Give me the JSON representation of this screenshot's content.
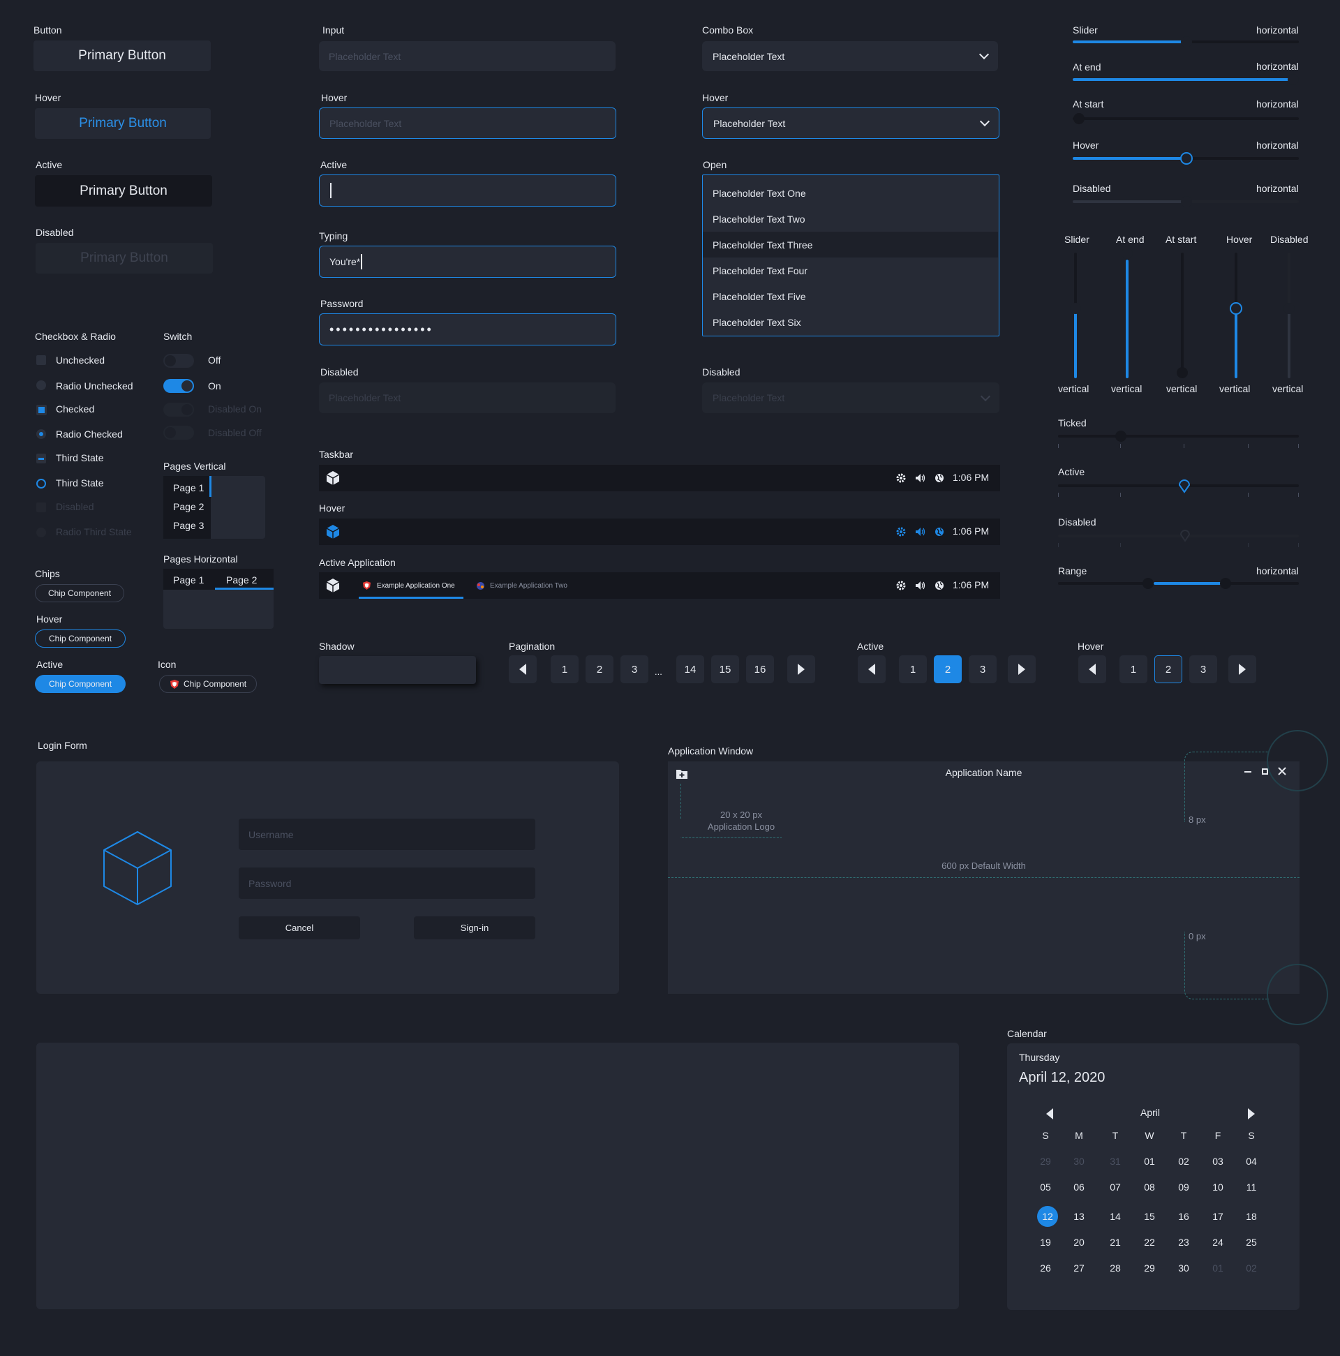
{
  "buttons": {
    "label": "Button",
    "primary": "Primary Button",
    "hover_label": "Hover",
    "hover": "Primary Button",
    "active_label": "Active",
    "active": "Primary Button",
    "disabled_label": "Disabled",
    "disabled": "Primary Button"
  },
  "inputs": {
    "label": "Input",
    "placeholder": "Placeholder Text",
    "hover_label": "Hover",
    "hover_placeholder": "Placeholder Text",
    "active_label": "Active",
    "typing_label": "Typing",
    "typing_value": "You're*",
    "password_label": "Password",
    "password_value": "••••••••••••••••",
    "disabled_label": "Disabled",
    "disabled_placeholder": "Placeholder Text"
  },
  "combo": {
    "label": "Combo Box",
    "value": "Placeholder Text",
    "hover_label": "Hover",
    "hover_value": "Placeholder Text",
    "open_label": "Open",
    "options": [
      "Placeholder Text One",
      "Placeholder Text Two",
      "Placeholder Text Three",
      "Placeholder Text Four",
      "Placeholder Text Five",
      "Placeholder Text Six"
    ],
    "disabled_label": "Disabled",
    "disabled_value": "Placeholder Text"
  },
  "sliders_h": [
    {
      "label": "Slider",
      "orientation": "horizontal",
      "value": 0.5
    },
    {
      "label": "At end",
      "orientation": "horizontal",
      "value": 1.0
    },
    {
      "label": "At start",
      "orientation": "horizontal",
      "value": 0.0
    },
    {
      "label": "Hover",
      "orientation": "horizontal",
      "value": 0.5
    },
    {
      "label": "Disabled",
      "orientation": "horizontal",
      "value": 0.5
    }
  ],
  "sliders_v": [
    {
      "label": "Slider",
      "orientation": "vertical",
      "value": 0.5
    },
    {
      "label": "At end",
      "orientation": "vertical",
      "value": 1.0
    },
    {
      "label": "At start",
      "orientation": "vertical",
      "value": 0.0
    },
    {
      "label": "Hover",
      "orientation": "vertical",
      "value": 0.5
    },
    {
      "label": "Disabled",
      "orientation": "vertical",
      "value": 0.5
    }
  ],
  "ticked": {
    "label": "Ticked",
    "active_label": "Active",
    "disabled_label": "Disabled"
  },
  "range": {
    "label": "Range",
    "orientation": "horizontal",
    "low": 0.38,
    "high": 0.7
  },
  "checkbox": {
    "title": "Checkbox & Radio",
    "items": [
      "Unchecked",
      "Radio Unchecked",
      "Checked",
      "Radio Checked",
      "Third State",
      "Third State",
      "Disabled",
      "Radio Third State"
    ]
  },
  "switch": {
    "title": "Switch",
    "items": [
      "Off",
      "On",
      "Disabled On",
      "Disabled Off"
    ]
  },
  "pages_vertical": {
    "title": "Pages Vertical",
    "items": [
      "Page 1",
      "Page 2",
      "Page 3"
    ]
  },
  "pages_horizontal": {
    "title": "Pages Horizontal",
    "items": [
      "Page 1",
      "Page 2"
    ]
  },
  "chips": {
    "title": "Chips",
    "label": "Chip Component",
    "hover_label": "Hover",
    "hover": "Chip Component",
    "active_label": "Active",
    "active": "Chip Component",
    "icon_label": "Icon",
    "icon": "Chip Component"
  },
  "taskbar": {
    "label": "Taskbar",
    "time": "1:06 PM",
    "hover_label": "Hover",
    "hover_time": "1:06 PM",
    "active_label": "Active Application",
    "active_time": "1:06 PM",
    "app_one": "Example Application One",
    "app_two": "Example Application Two"
  },
  "shadow": {
    "label": "Shadow"
  },
  "pagination": {
    "label": "Pagination",
    "pages": [
      "1",
      "2",
      "3",
      "...",
      "14",
      "15",
      "16"
    ],
    "active_label": "Active",
    "active_pages": [
      "1",
      "2",
      "3"
    ],
    "active_selected": "2",
    "hover_label": "Hover",
    "hover_pages": [
      "1",
      "2",
      "3"
    ],
    "hover_selected": "2"
  },
  "login": {
    "title": "Login Form",
    "username_placeholder": "Username",
    "password_placeholder": "Password",
    "cancel": "Cancel",
    "signin": "Sign-in"
  },
  "app_window": {
    "title": "Application Window",
    "app_name": "Application Name",
    "logo_note_1": "20 x 20 px",
    "logo_note_2": "Application Logo",
    "width_note": "600 px Default Width",
    "pad_top": "8 px",
    "pad_bottom": "0 px"
  },
  "calendar": {
    "title": "Calendar",
    "weekday": "Thursday",
    "date": "April 12, 2020",
    "month": "April",
    "days_header": [
      "S",
      "M",
      "T",
      "W",
      "T",
      "F",
      "S"
    ],
    "weeks": [
      [
        "29",
        "30",
        "31",
        "01",
        "02",
        "03",
        "04"
      ],
      [
        "05",
        "06",
        "07",
        "08",
        "09",
        "10",
        "11"
      ],
      [
        "12",
        "13",
        "14",
        "15",
        "16",
        "17",
        "18"
      ],
      [
        "19",
        "20",
        "21",
        "22",
        "23",
        "24",
        "25"
      ],
      [
        "26",
        "27",
        "28",
        "29",
        "30",
        "01",
        "02"
      ]
    ],
    "selected": "12"
  },
  "colors": {
    "accent": "#1e88e5",
    "background": "#1d2029",
    "surface": "#262a35",
    "dark": "#15171e"
  }
}
